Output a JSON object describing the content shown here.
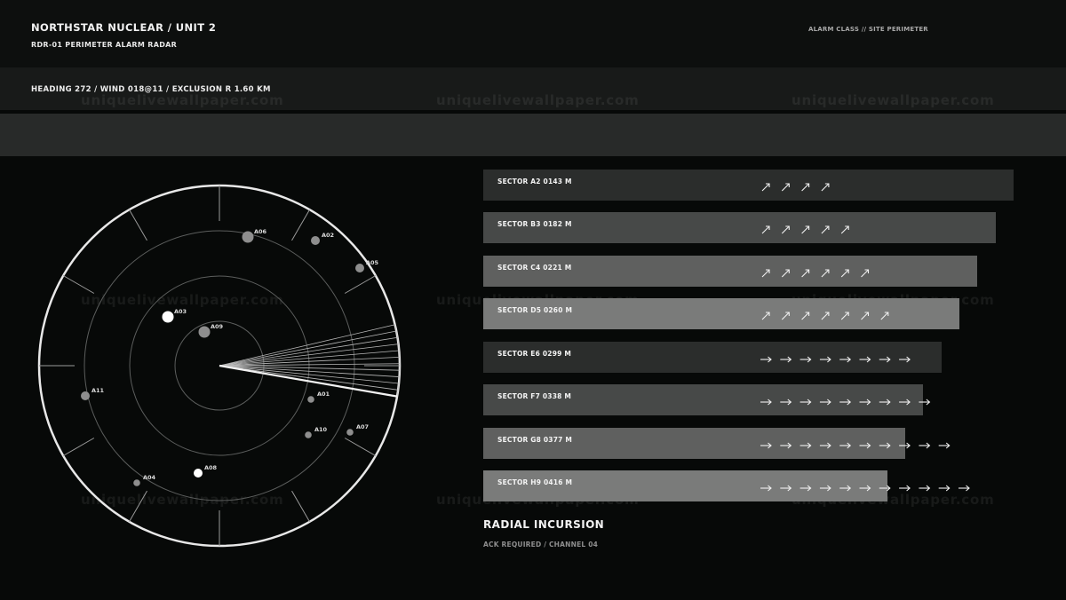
{
  "header": {
    "title": "NORTHSTAR NUCLEAR / UNIT 2",
    "subtitle": "RDR-01  PERIMETER ALARM RADAR",
    "alarm_class": "ALARM CLASS // SITE PERIMETER"
  },
  "status": {
    "text": "HEADING  272  /  WIND  018@11  /  EXCLUSION R 1.60 KM"
  },
  "watermark": "uniquelivewallpaper.com",
  "radar": {
    "contacts": [
      {
        "id": "A06",
        "tone": "mid",
        "size": "lg"
      },
      {
        "id": "A02",
        "tone": "mid",
        "size": "md"
      },
      {
        "id": "A05",
        "tone": "mid",
        "size": "md"
      },
      {
        "id": "A03",
        "tone": "white",
        "size": "lg"
      },
      {
        "id": "A09",
        "tone": "mid",
        "size": "lg"
      },
      {
        "id": "A11",
        "tone": "mid",
        "size": "md"
      },
      {
        "id": "A01",
        "tone": "mid",
        "size": "sm"
      },
      {
        "id": "A10",
        "tone": "mid",
        "size": "sm"
      },
      {
        "id": "A07",
        "tone": "mid",
        "size": "sm"
      },
      {
        "id": "A08",
        "tone": "white",
        "size": "md"
      },
      {
        "id": "A04",
        "tone": "mid",
        "size": "sm"
      }
    ]
  },
  "sectors": [
    {
      "label": "SECTOR A2  0143 M",
      "color": "#2b2d2c",
      "arrow_glyph": "↗",
      "arrow_count": 4
    },
    {
      "label": "SECTOR B3  0182 M",
      "color": "#474948",
      "arrow_glyph": "↗",
      "arrow_count": 5
    },
    {
      "label": "SECTOR C4  0221 M",
      "color": "#5f605f",
      "arrow_glyph": "↗",
      "arrow_count": 6
    },
    {
      "label": "SECTOR D5  0260 M",
      "color": "#7a7b7a",
      "arrow_glyph": "↗",
      "arrow_count": 7
    },
    {
      "label": "SECTOR E6  0299 M",
      "color": "#2b2d2c",
      "arrow_glyph": "→",
      "arrow_count": 8
    },
    {
      "label": "SECTOR F7  0338 M",
      "color": "#474948",
      "arrow_glyph": "→",
      "arrow_count": 9
    },
    {
      "label": "SECTOR G8  0377 M",
      "color": "#5f605f",
      "arrow_glyph": "→",
      "arrow_count": 10
    },
    {
      "label": "SECTOR H9  0416 M",
      "color": "#7a7b7a",
      "arrow_glyph": "→",
      "arrow_count": 11
    }
  ],
  "incursion": {
    "title": "RADIAL INCURSION",
    "subtitle": "ACK REQUIRED / CHANNEL 04"
  }
}
